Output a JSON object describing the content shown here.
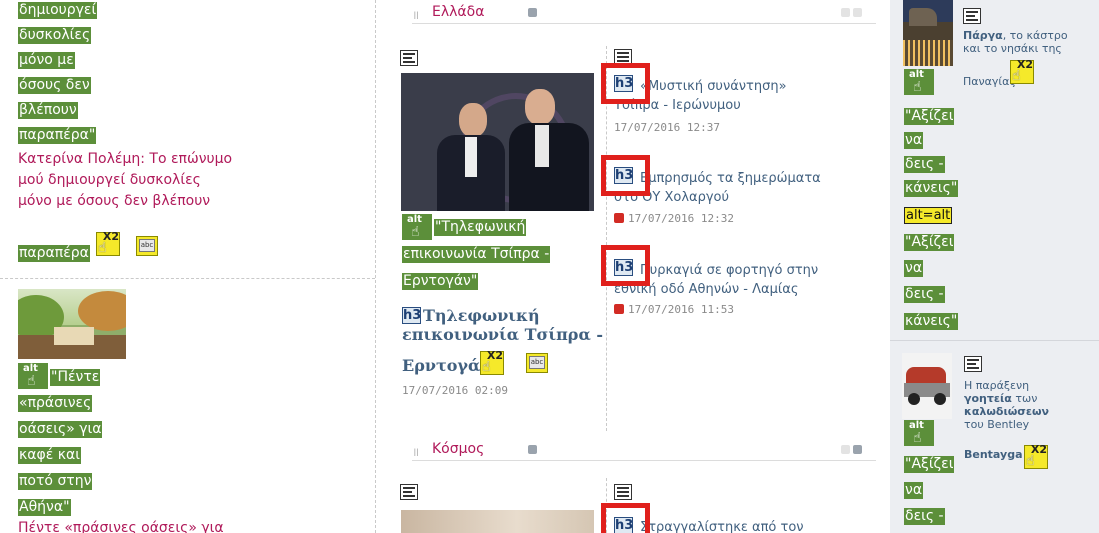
{
  "left": {
    "alt_lines_top": [
      "δημιουργεί",
      "δυσκολίες",
      "μόνο με",
      "όσους δεν",
      "βλέπουν",
      "παραπέρα\""
    ],
    "title_lines": [
      "Κατερίνα Πολέμη: Το επώνυμο",
      "μού δημιουργεί δυσκολίες",
      "μόνο με όσους δεν βλέπουν"
    ],
    "title_last": "παραπέρα",
    "alt_lines_second": [
      "\"Πέντε",
      "«πράσινες",
      "οάσεις» για",
      "καφέ και",
      "ποτό στην",
      "Αθήνα\""
    ],
    "cut_title": "Πέντε «πράσινες οάσεις» για"
  },
  "middle": {
    "section1_title": "Ελλάδα",
    "section2_title": "Κόσμος",
    "main_alt_lines": [
      "\"Τηλεφωνική",
      "επικοινωνία Τσίπρα -",
      "Ερντογάν\""
    ],
    "main_title_lines": [
      "Τηλεφωνική",
      "επικοινωνία Τσίπρα -",
      "Ερντογάν"
    ],
    "main_date": "17/07/2016 02:09",
    "h3_label": "h3",
    "articles": [
      {
        "line1": "«Μυστική συνάντηση»",
        "line2": "Τσίπρα - Ιερώνυμου",
        "date": "17/07/2016 12:37"
      },
      {
        "line1": "Εμπρησμός τα ξημερώματα",
        "line2": "στο ΟΥ Χολαργού",
        "date": "17/07/2016 12:32"
      },
      {
        "line1": "Πυρκαγιά σε φορτηγό στην",
        "line2": "εθνική οδό Αθηνών - Λαμίας",
        "date": "17/07/2016 11:53"
      }
    ],
    "kosmos_article": "Στραγγαλίστηκε από τον"
  },
  "right": {
    "parga_bold": "Πάργα",
    "parga_rest": ", το κάστρο",
    "parga_line2": "και το νησάκι της",
    "parga_line3": "Παναγίας",
    "alt_lines_1": [
      "\"Αξίζει",
      "να",
      "δεις -",
      "κάνεις\""
    ],
    "alt_eq": "alt=alt",
    "alt_lines_2": [
      "\"Αξίζει",
      "να",
      "δεις -",
      "κάνεις\""
    ],
    "bentley_l1": "Η παράξενη",
    "bentley_l2_bold": "γοητεία",
    "bentley_l2_rest": " των",
    "bentley_l3_bold": "καλωδιώσεων",
    "bentley_l4": "του Bentley",
    "bentley_l5": "Bentayga",
    "alt_lines_3": [
      "\"Αξίζει",
      "να",
      "δεις -"
    ]
  },
  "icons": {
    "alt_text": "alt",
    "x2_text": "X2",
    "abc_text": "abc"
  },
  "colors": {
    "alt_green": "#5c8f3a",
    "title_pink": "#b01a5a",
    "link_blue": "#41607f",
    "highlight_red": "#e0201c",
    "badge_yellow": "#f5e92a"
  }
}
